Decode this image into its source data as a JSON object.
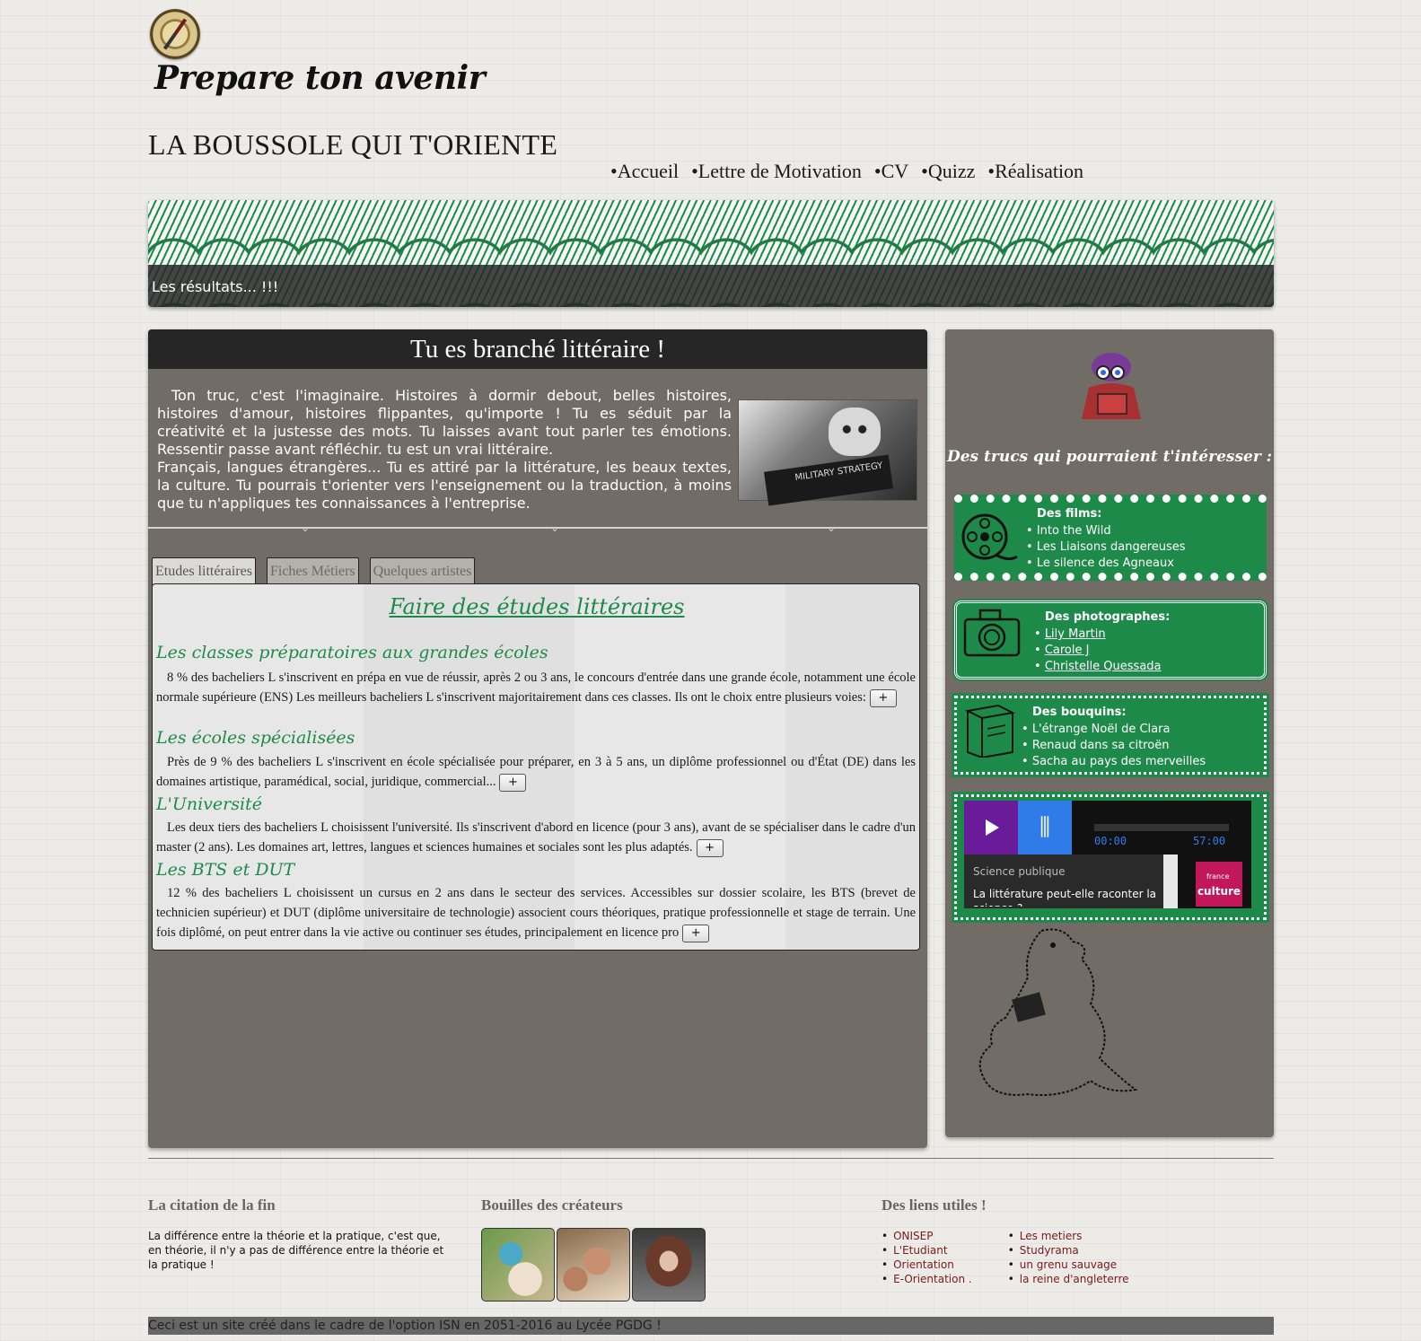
{
  "header": {
    "tagline": "Prepare ton avenir",
    "site_title": "LA BOUSSOLE QUI T'ORIENTE",
    "nav": [
      "•Accueil",
      "•Lettre de Motivation",
      "•CV",
      "•Quizz",
      "•Réalisation"
    ]
  },
  "banner": {
    "text": "Les résultats... !!!"
  },
  "main": {
    "heading": "Tu es branché littéraire !",
    "intro_p1": "Ton truc, c'est l'imaginaire. Histoires à dormir debout, belles histoires, histoires d'amour, histoires flippantes, qu'importe ! Tu es séduit par la créativité et la justesse des mots. Tu laisses avant tout parler tes émotions. Ressentir passe avant réfléchir. tu est un vrai littéraire.",
    "intro_p2": "Français, langues étrangères... Tu es attiré par la littérature, les beaux textes, la culture. Tu pourrais t'orienter vers l'enseignement ou la traduction, à moins que tu n'appliques tes connaissances à l'entreprise.",
    "photo_book_text": "MILITARY STRATEGY",
    "tabs": [
      "Etudes littéraires",
      "Fiches Métiers",
      "Quelques artistes"
    ],
    "tab_title": "Faire des études littéraires",
    "sections": [
      {
        "heading": "Les classes préparatoires aux grandes écoles",
        "text": "8 % des bacheliers L s'inscrivent en prépa en vue de réussir, après 2 ou 3 ans, le concours d'entrée dans une grande école, notamment une école normale supérieure (ENS) Les meilleurs bacheliers L s'inscrivent majoritairement dans ces classes. Ils ont le choix entre plusieurs voies:"
      },
      {
        "heading": "Les écoles spécialisées",
        "text": "Près de 9 % des bacheliers L s'inscrivent en école spécialisée pour préparer, en 3 à 5 ans, un diplôme professionnel ou d'État (DE) dans les domaines artistique, paramédical, social, juridique, commercial..."
      },
      {
        "heading": "L'Université",
        "text": "Les deux tiers des bacheliers L choisissent l'université. Ils s'inscrivent d'abord en licence (pour 3 ans), avant de se spécialiser dans le cadre d'un master (2 ans). Les domaines art, lettres, langues et sciences humaines et sociales sont les plus adaptés."
      },
      {
        "heading": "Les BTS et DUT",
        "text": "12 % des bacheliers L choisissent un cursus en 2 ans dans le secteur des services. Accessibles sur dossier scolaire, les BTS (brevet de technicien supérieur) et DUT (diplôme universitaire de technologie) associent cours théoriques, pratique professionnelle et stage de terrain. Une fois diplômé, on peut entrer dans la vie active ou continuer ses études, principalement en licence pro"
      }
    ],
    "more_label": "+"
  },
  "sidebar": {
    "heading": "Des trucs qui pourraient t'intéresser :",
    "films": {
      "title": "Des films:",
      "items": [
        "Into the Wild",
        "Les Liaisons dangereuses",
        "Le silence des Agneaux"
      ]
    },
    "photos": {
      "title": "Des photographes:",
      "items": [
        "Lily Martin",
        "Carole J",
        "Christelle Quessada"
      ]
    },
    "books": {
      "title": "Des bouquins:",
      "items": [
        "L'étrange Noël de Clara",
        "Renaud dans sa citroën",
        "Sacha au pays des merveilles"
      ]
    },
    "player": {
      "time_start": "00:00",
      "time_end": "57:00",
      "show": "Science publique",
      "episode": "La littérature peut-elle raconter la science ?",
      "logo": "culture",
      "logo_small": "france"
    }
  },
  "footer": {
    "quote_heading": "La citation de la fin",
    "quote": "La différence entre la théorie et la pratique, c'est que, en théorie, il n'y a pas de différence entre la théorie et la pratique !",
    "creators_heading": "Bouilles des créateurs",
    "links_heading": "Des liens utiles !",
    "links_col1": [
      "ONISEP",
      "L'Etudiant",
      "Orientation",
      "E-Orientation ."
    ],
    "links_col2": [
      "Les metiers",
      "Studyrama",
      "un grenu sauvage",
      "la reine d'angleterre"
    ],
    "bottom": "Ceci est un site créé dans le cadre de l'option ISN en 2051-2016 au Lycée PGDG !"
  },
  "colors": {
    "accent_green": "#1e8a4a",
    "panel": "#716c66",
    "heading_bg": "#262626"
  }
}
